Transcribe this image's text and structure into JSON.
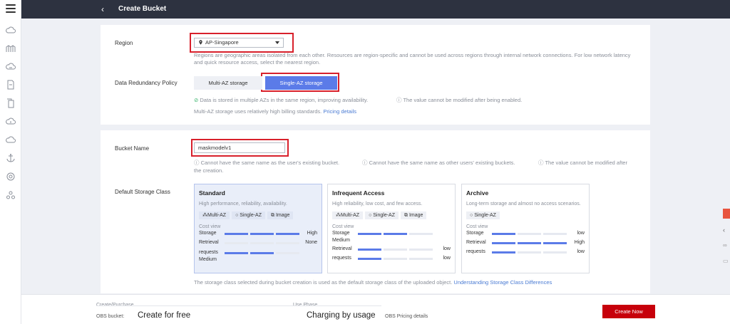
{
  "header": {
    "back_icon": "chevron-left-icon",
    "title": "Create Bucket"
  },
  "region": {
    "label": "Region",
    "value": "AP-Singapore",
    "help": "Regions are geographic areas isolated from each other. Resources are region-specific and cannot be used across regions through internal network connections. For low network latency and quick resource access, select the nearest region."
  },
  "redundancy": {
    "label": "Data Redundancy Policy",
    "options": [
      "Multi-AZ storage",
      "Single-AZ storage"
    ],
    "selected": "Single-AZ storage",
    "note1": "Data is stored in multiple AZs in the same region, improving availability.",
    "note2": "The value cannot be modified after being enabled.",
    "billing": "Multi-AZ storage uses relatively high billing standards.",
    "pricing_link": "Pricing details"
  },
  "bucket_name": {
    "label": "Bucket Name",
    "value": "maskmodelv1",
    "rule1": "Cannot have the same name as the user's existing bucket.",
    "rule2": "Cannot have the same name as other users' existing buckets.",
    "rule3": "The value cannot be modified after",
    "rule3b": "the creation."
  },
  "storage_class": {
    "label": "Default Storage Class",
    "cost_view": "Cost view",
    "standard": {
      "name": "Standard",
      "desc": "High performance, reliability, availability.",
      "tags": [
        "Multi-AZ",
        "Single-AZ",
        "Image"
      ],
      "storage_k": "Storage",
      "storage_v": "High",
      "retrieval_k": "Retrieval",
      "retrieval_v": "None",
      "requests_k": "requests",
      "requests_v": "Medium"
    },
    "infrequent": {
      "name": "Infrequent Access",
      "desc": "High reliability, low cost, and few access.",
      "tags": [
        "Multi-AZ",
        "Single-AZ",
        "Image"
      ],
      "storage_k": "Storage",
      "storage_v": "Medium",
      "retrieval_k": "Retrieval",
      "retrieval_v": "low",
      "requests_k": "requests",
      "requests_v": "low"
    },
    "archive": {
      "name": "Archive",
      "desc": "Long-term storage and almost no access scenarios.",
      "tags": [
        "Single-AZ"
      ],
      "storage_k": "Storage",
      "storage_v": "low",
      "retrieval_k": "Retrieval",
      "retrieval_v": "High",
      "requests_k": "requests",
      "requests_v": "low"
    },
    "note": "The storage class selected during bucket creation is used as the default storage class of the uploaded object.",
    "link": "Understanding Storage Class Differences"
  },
  "footer": {
    "phase1": "Create/Purchase",
    "phase2": "Use Phase",
    "obs_label": "OBS bucket:",
    "create_free": "Create for free",
    "charging": "Charging by usage",
    "pricing_link": "OBS Pricing details",
    "create_now": "Create Now"
  },
  "colors": {
    "accent": "#5b7be8",
    "primary_button": "#c7000b",
    "highlight_box": "#d8202b",
    "topbar": "#2d3240"
  }
}
